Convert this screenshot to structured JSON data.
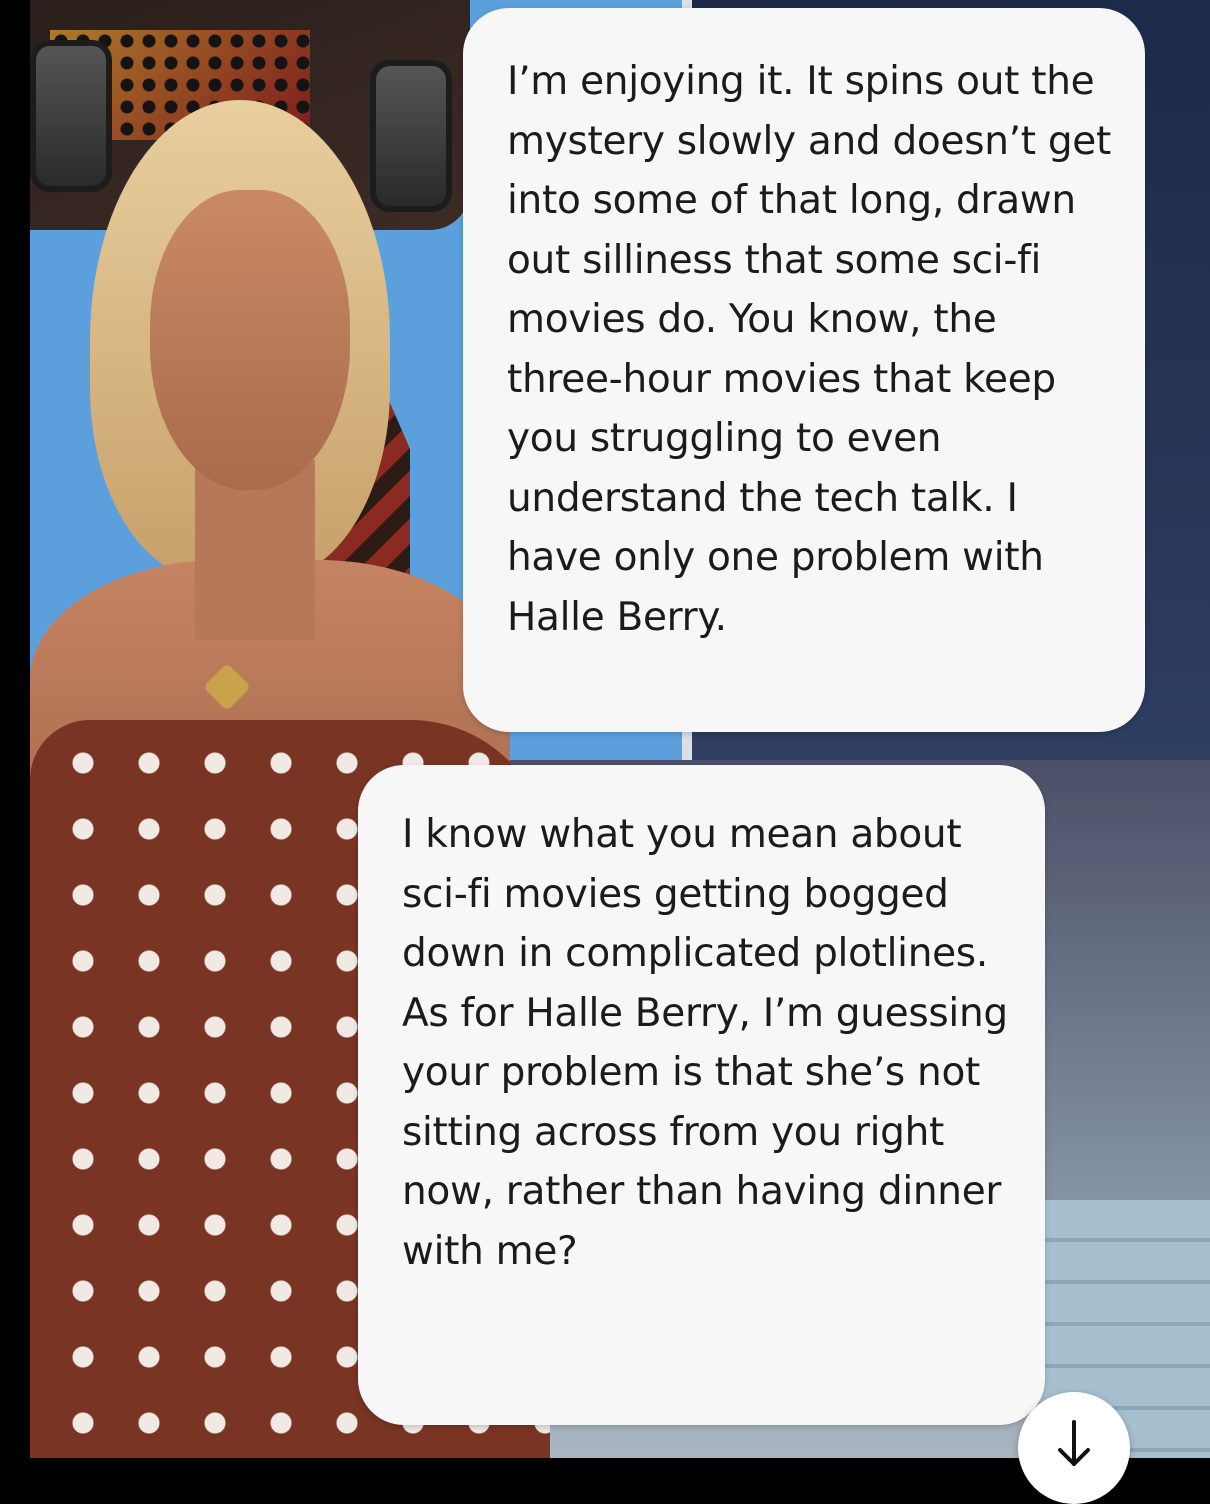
{
  "chat": {
    "messages": [
      {
        "sender": "user",
        "text": "I’m enjoying it. It spins out the mystery slowly and doesn’t get into some of that long, drawn out silliness that some sci-fi movies do. You know, the three-hour movies that keep you struggling to even understand the tech talk. I have only one problem with Halle Berry."
      },
      {
        "sender": "companion",
        "text": "I know what you mean about sci-fi movies getting bogged down in complicated plotlines. As for Halle Berry, I’m guessing your problem is that she’s not sitting across from you right now, rather than having dinner with me?"
      }
    ]
  },
  "controls": {
    "scroll_down_icon": "arrow-down-icon"
  },
  "colors": {
    "bubble_background": "#f7f7f8",
    "text": "#1b1b1b",
    "wall_left": "#5b9fdc",
    "wall_right": "#1d2a4a"
  }
}
